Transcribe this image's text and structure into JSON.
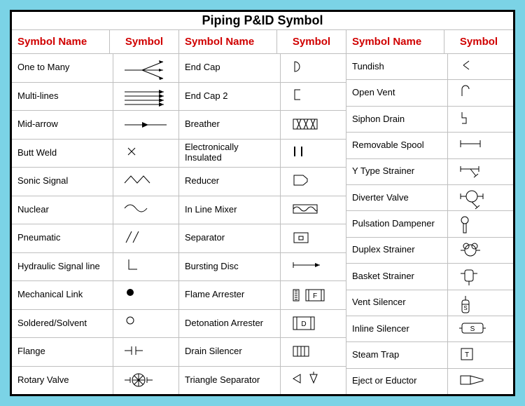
{
  "title": "Piping P&ID Symbol",
  "header": {
    "name": "Symbol Name",
    "symbol": "Symbol"
  },
  "columns": [
    [
      {
        "name": "One to Many",
        "icon": "one-to-many"
      },
      {
        "name": "Multi-lines",
        "icon": "multi-lines"
      },
      {
        "name": "Mid-arrow",
        "icon": "mid-arrow"
      },
      {
        "name": "Butt Weld",
        "icon": "butt-weld"
      },
      {
        "name": "Sonic Signal",
        "icon": "sonic-signal"
      },
      {
        "name": "Nuclear",
        "icon": "nuclear"
      },
      {
        "name": "Pneumatic",
        "icon": "pneumatic"
      },
      {
        "name": "Hydraulic Signal line",
        "icon": "hydraulic-signal"
      },
      {
        "name": "Mechanical Link",
        "icon": "mechanical-link"
      },
      {
        "name": "Soldered/Solvent",
        "icon": "soldered"
      },
      {
        "name": "Flange",
        "icon": "flange"
      },
      {
        "name": "Rotary Valve",
        "icon": "rotary-valve"
      }
    ],
    [
      {
        "name": "End Cap",
        "icon": "end-cap"
      },
      {
        "name": "End Cap 2",
        "icon": "end-cap-2"
      },
      {
        "name": "Breather",
        "icon": "breather"
      },
      {
        "name": "Electronically Insulated",
        "icon": "electronically-insulated"
      },
      {
        "name": "Reducer",
        "icon": "reducer"
      },
      {
        "name": "In Line Mixer",
        "icon": "inline-mixer"
      },
      {
        "name": "Separator",
        "icon": "separator"
      },
      {
        "name": "Bursting Disc",
        "icon": "bursting-disc"
      },
      {
        "name": "Flame Arrester",
        "icon": "flame-arrester"
      },
      {
        "name": "Detonation Arrester",
        "icon": "detonation-arrester"
      },
      {
        "name": "Drain Silencer",
        "icon": "drain-silencer"
      },
      {
        "name": "Triangle Separator",
        "icon": "triangle-separator"
      }
    ],
    [
      {
        "name": "Tundish",
        "icon": "tundish"
      },
      {
        "name": "Open Vent",
        "icon": "open-vent"
      },
      {
        "name": "Siphon Drain",
        "icon": "siphon-drain"
      },
      {
        "name": "Removable Spool",
        "icon": "removable-spool"
      },
      {
        "name": "Y Type Strainer",
        "icon": "y-strainer"
      },
      {
        "name": "Diverter Valve",
        "icon": "diverter-valve"
      },
      {
        "name": "Pulsation Dampener",
        "icon": "pulsation-dampener"
      },
      {
        "name": "Duplex Strainer",
        "icon": "duplex-strainer"
      },
      {
        "name": "Basket Strainer",
        "icon": "basket-strainer"
      },
      {
        "name": "Vent Silencer",
        "icon": "vent-silencer"
      },
      {
        "name": "Inline Silencer",
        "icon": "inline-silencer"
      },
      {
        "name": "Steam Trap",
        "icon": "steam-trap"
      },
      {
        "name": "Eject or Eductor",
        "icon": "eductor"
      }
    ]
  ]
}
